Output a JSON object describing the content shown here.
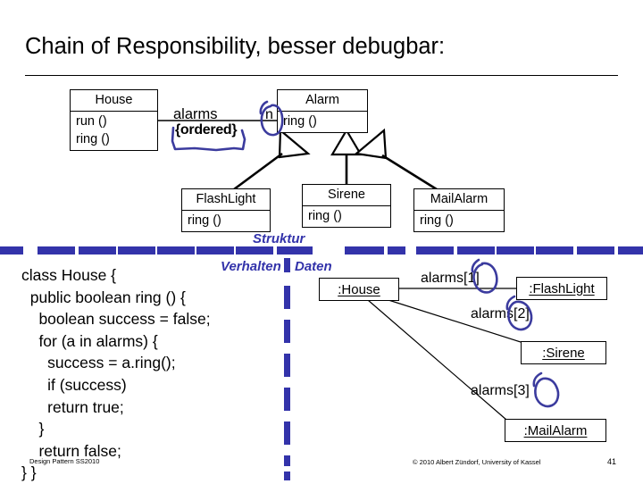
{
  "slide": {
    "title": "Chain of Responsibility, besser debugbar:",
    "page_number": "41",
    "footer_left": "Design Pattern SS2010",
    "footer_copyright": "© 2010 Albert Zündorf, University of Kassel",
    "accent_color": "#3333aa",
    "text_color": "#000000",
    "background_color": "#ffffff"
  },
  "class_diagram": {
    "classes": [
      {
        "name": "House",
        "operations": [
          "run ()",
          "ring ()"
        ]
      },
      {
        "name": "Alarm",
        "operations": [
          "ring ()"
        ]
      },
      {
        "name": "FlashLight",
        "operations": [
          "ring ()"
        ]
      },
      {
        "name": "Sirene",
        "operations": [
          "ring ()"
        ]
      },
      {
        "name": "MailAlarm",
        "operations": [
          "ring ()"
        ]
      }
    ],
    "association": {
      "role_label": "alarms",
      "constraint": "{ordered}",
      "multiplicity": "n"
    }
  },
  "divider": {
    "label_struktur": "Struktur",
    "label_verhalten": "Verhalten",
    "label_daten": "Daten"
  },
  "code": {
    "lines": [
      "class House {",
      "  public boolean ring () {",
      "    boolean success = false;",
      "    for (a in alarms) {",
      "      success = a.ring();",
      "      if (success)",
      "      return true;",
      "    }",
      "    return false;",
      "} }"
    ]
  },
  "object_diagram": {
    "objects": [
      {
        "name": ":House"
      },
      {
        "name": ":FlashLight"
      },
      {
        "name": ":Sirene"
      },
      {
        "name": ":MailAlarm"
      }
    ],
    "links": [
      {
        "label": "alarms[1]"
      },
      {
        "label": "alarms[2]"
      },
      {
        "label": "alarms[3]"
      }
    ]
  }
}
